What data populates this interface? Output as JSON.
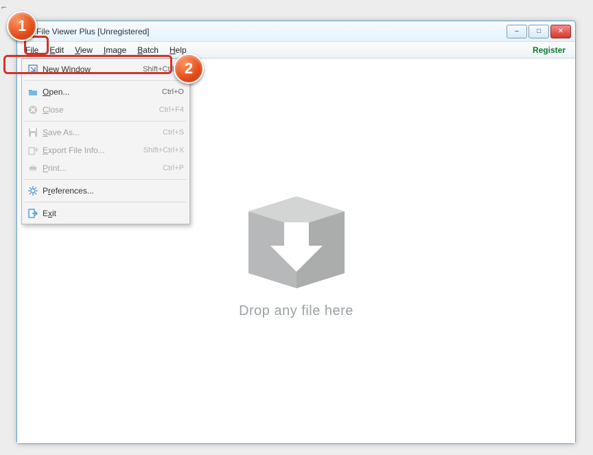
{
  "window": {
    "title": "File Viewer Plus [Unregistered]",
    "controls": {
      "minimize": "–",
      "maximize": "□",
      "close": "✕"
    }
  },
  "menubar": {
    "items": [
      {
        "label": "File",
        "accel": "F"
      },
      {
        "label": "Edit",
        "accel": "E"
      },
      {
        "label": "View",
        "accel": "V"
      },
      {
        "label": "Image",
        "accel": "I"
      },
      {
        "label": "Batch",
        "accel": "B"
      },
      {
        "label": "Help",
        "accel": "H"
      }
    ],
    "register": "Register"
  },
  "file_menu": {
    "items": [
      {
        "icon": "new-window-icon",
        "label": "New Window",
        "accel": "N",
        "shortcut": "Shift+Ctrl+N",
        "enabled": true
      },
      {
        "icon": "open-folder-icon",
        "label": "Open...",
        "accel": "O",
        "shortcut": "Ctrl+O",
        "enabled": true
      },
      {
        "icon": "close-x-icon",
        "label": "Close",
        "accel": "C",
        "shortcut": "Ctrl+F4",
        "enabled": false
      },
      {
        "icon": "save-disk-icon",
        "label": "Save As...",
        "accel": "S",
        "shortcut": "Ctrl+S",
        "enabled": false
      },
      {
        "icon": "export-icon",
        "label": "Export File Info...",
        "accel": "E",
        "shortcut": "Shift+Ctrl+X",
        "enabled": false
      },
      {
        "icon": "print-icon",
        "label": "Print...",
        "accel": "P",
        "shortcut": "Ctrl+P",
        "enabled": false
      },
      {
        "icon": "gear-icon",
        "label": "Preferences...",
        "accel": "r",
        "shortcut": "",
        "enabled": true
      },
      {
        "icon": "exit-icon",
        "label": "Exit",
        "accel": "x",
        "shortcut": "",
        "enabled": true
      }
    ],
    "separators_after": [
      0,
      2,
      5,
      6
    ]
  },
  "dropzone": {
    "label": "Drop any file here"
  },
  "annotations": {
    "badge1": "1",
    "badge2": "2"
  },
  "cropmark": "⌐"
}
